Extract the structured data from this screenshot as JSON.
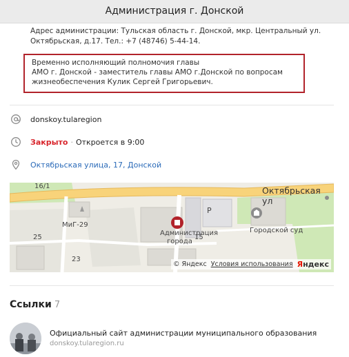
{
  "header": {
    "title": "Администрация г. Донской"
  },
  "info": {
    "address_line1": "Адрес администрации: Тульская область г. Донской, мкр. Центральный ул.",
    "address_line2": "Октябрьская, д.17. Тел.: +7 (48746) 5-44-14."
  },
  "highlight": {
    "line1": "Временно исполняющий полномочия главы",
    "line2": "АМО г. Донской - заместитель главы АМО г.Донской по вопросам",
    "line3": "жизнеобеспечения Кулик Сергей Григорьевич."
  },
  "contacts": {
    "website": "donskoy.tularegion",
    "status_closed": "Закрыто",
    "status_open_time": "Откроется в 9:00",
    "address": "Октябрьская улица, 17, Донской"
  },
  "map": {
    "street_label": "Октябрьская ул",
    "building_label_line1": "Администрация",
    "building_label_line2": "города",
    "court_label": "Городской суд",
    "monument_label": "МиГ-29",
    "house_16_1": "16/1",
    "house_25": "25",
    "house_23": "23",
    "house_15": "15",
    "parking": "P",
    "copyright": "© Яндекс",
    "terms": "Условия использования",
    "logo_y": "Я",
    "logo_rest": "ндекс"
  },
  "links": {
    "title": "Ссылки",
    "count": "7",
    "items": [
      {
        "title": "Официальный сайт администрации муниципального образования",
        "url": "donskoy.tularegion.ru"
      }
    ]
  },
  "colors": {
    "accent_red": "#b1222a",
    "link_blue": "#2a6ab8",
    "closed_red": "#d8242b"
  }
}
